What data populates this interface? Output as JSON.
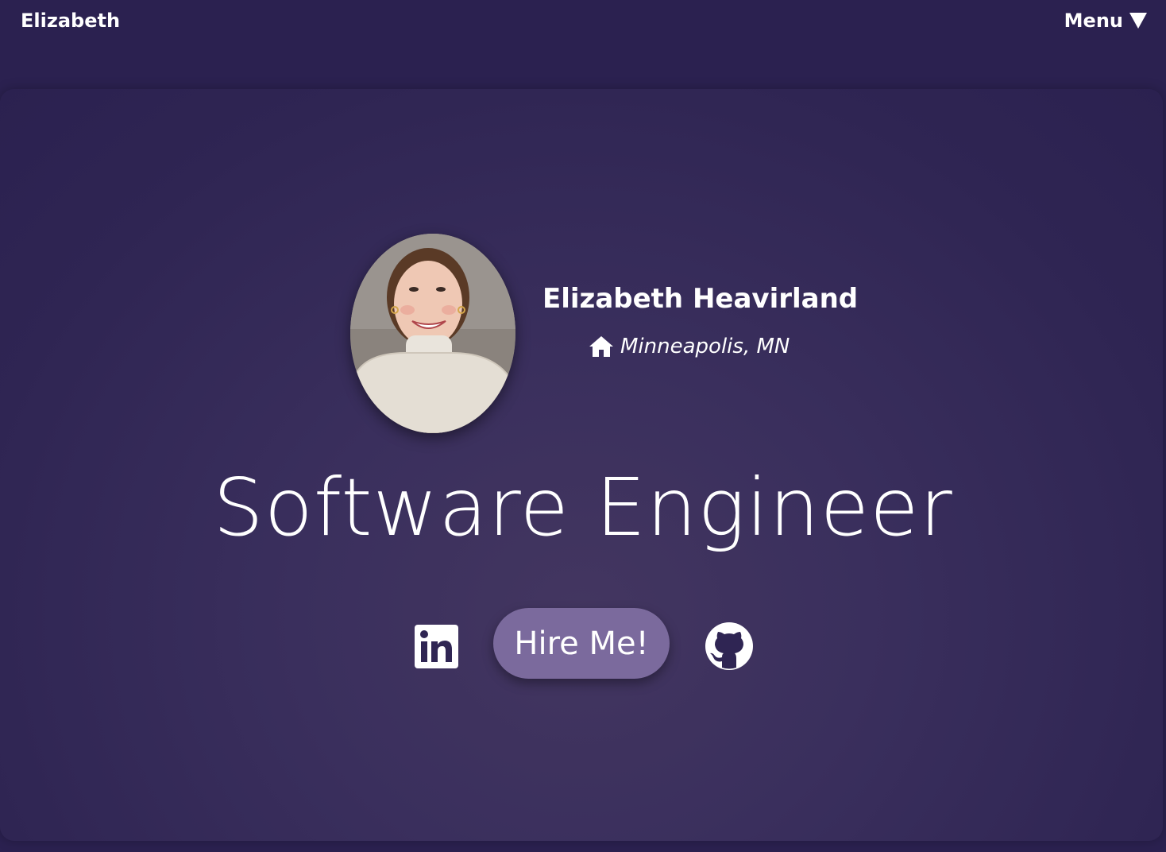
{
  "navbar": {
    "brand": "Elizabeth",
    "menu_label": "Menu",
    "menu_icon": "triangle-down-icon"
  },
  "profile": {
    "photo": "profile-photo",
    "name": "Elizabeth Heavirland",
    "location_icon": "home-icon",
    "location": "Minneapolis, MN"
  },
  "hero": {
    "title": "Software Engineer",
    "hire_button": "Hire Me!",
    "social": [
      "linkedin-icon",
      "github-icon"
    ]
  },
  "colors": {
    "background": "#2b2150",
    "button": "#7b6a9d",
    "text": "#ffffff"
  }
}
